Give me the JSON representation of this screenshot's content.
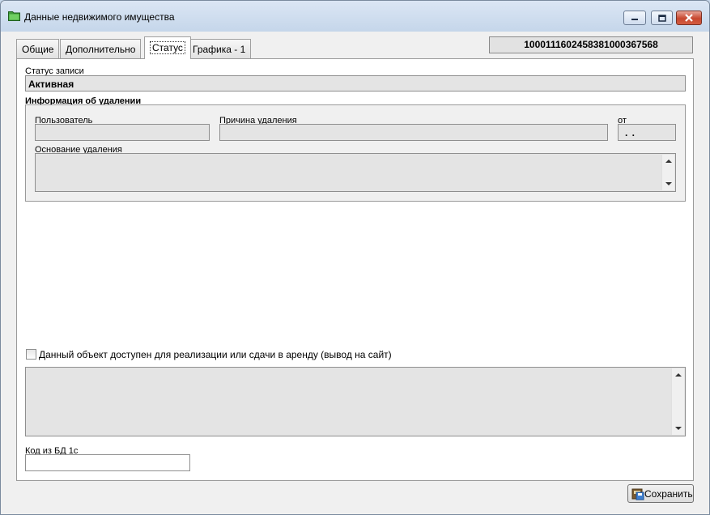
{
  "window": {
    "title": "Данные недвижимого имущества"
  },
  "tabs": [
    {
      "label": "Общие",
      "active": false
    },
    {
      "label": "Дополнительно",
      "active": false
    },
    {
      "label": "Статус",
      "active": true
    },
    {
      "label": "Графика - 1",
      "active": false
    }
  ],
  "record_id": "10001116024583810003675​68",
  "status": {
    "label": "Статус записи",
    "value": "Активная"
  },
  "deletion": {
    "heading": "Информация об удалении",
    "user_label": "Пользователь",
    "user_value": "",
    "reason_label": "Причина удаления",
    "reason_value": "",
    "date_label": "от",
    "date_value": ". .",
    "basis_label": "Основание удаления",
    "basis_value": ""
  },
  "website": {
    "checkbox_label": "Данный объект доступен для реализации или сдачи в аренду (вывод на сайт)",
    "checked": false,
    "text_value": ""
  },
  "db_code": {
    "label": "Код из БД 1с",
    "value": ""
  },
  "buttons": {
    "save_label": "Сохранить"
  },
  "colors": {
    "panel_bg": "#ffffff",
    "field_bg": "#e4e4e4",
    "window_bg": "#f0f0f0"
  }
}
